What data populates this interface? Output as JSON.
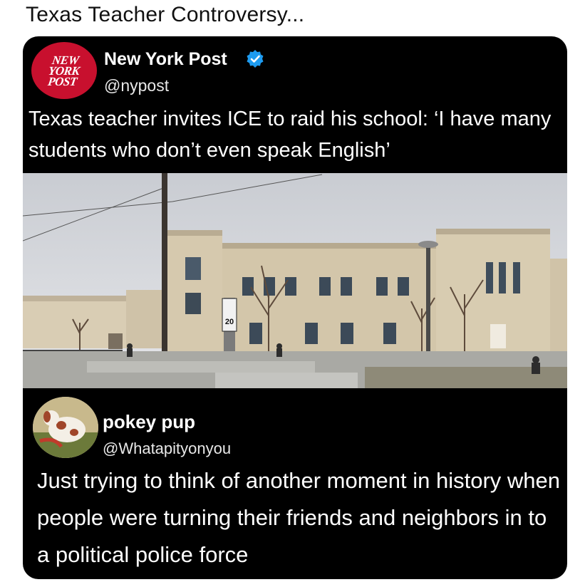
{
  "page": {
    "title": "Texas Teacher Controversy..."
  },
  "post": {
    "logo_text": "NEW\nYORK\nPOST",
    "account_name": "New York Post",
    "handle": "@nypost",
    "verified": true,
    "text": "Texas teacher invites ICE to raid his school: ‘I have many students who don’t even speak English’",
    "sign_number": "20"
  },
  "reply": {
    "account_name": "pokey pup",
    "handle": "@Whatapityonyou",
    "text": "Just trying to think of another moment in history when people were turning their friends and neighbors in to a political police force"
  },
  "colors": {
    "card_background": "#000000",
    "logo_red": "#c8102e",
    "verified_blue": "#1d9bf0",
    "text_white": "#ffffff"
  }
}
